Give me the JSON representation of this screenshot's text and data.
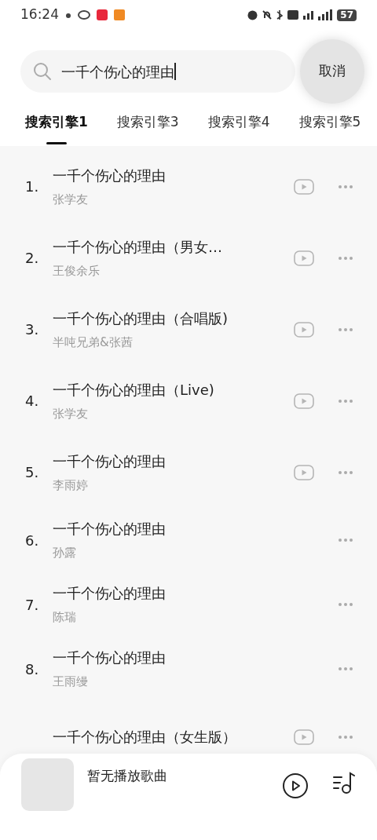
{
  "status_bar": {
    "time": "16:24",
    "battery": "57"
  },
  "search": {
    "value": "一千个伤心的理由",
    "cancel": "取消"
  },
  "tabs": [
    {
      "label": "搜索引擎1",
      "selected": true
    },
    {
      "label": "搜索引擎3",
      "selected": false
    },
    {
      "label": "搜索引擎4",
      "selected": false
    },
    {
      "label": "搜索引擎5",
      "selected": false
    }
  ],
  "songs": [
    {
      "number": "1.",
      "title": "一千个伤心的理由",
      "artist": "张学友",
      "has_video": true
    },
    {
      "number": "2.",
      "title": "一千个伤心的理由（男女…",
      "artist": "王俊余乐",
      "has_video": true
    },
    {
      "number": "3.",
      "title": "一千个伤心的理由（合唱版)",
      "artist": "半吨兄弟&张茜",
      "has_video": true
    },
    {
      "number": "4.",
      "title": "一千个伤心的理由（Live)",
      "artist": "张学友",
      "has_video": true
    },
    {
      "number": "5.",
      "title": "一千个伤心的理由",
      "artist": "李雨婷",
      "has_video": true
    },
    {
      "number": "6.",
      "title": "一千个伤心的理由",
      "artist": "孙露",
      "has_video": false
    },
    {
      "number": "7.",
      "title": "一千个伤心的理由",
      "artist": "陈瑞",
      "has_video": false
    },
    {
      "number": "8.",
      "title": "一千个伤心的理由",
      "artist": "王雨缦",
      "has_video": false
    },
    {
      "title": "一千个伤心的理由（女生版）",
      "has_video": true
    }
  ],
  "player": {
    "now_playing": "暂无播放歌曲"
  }
}
